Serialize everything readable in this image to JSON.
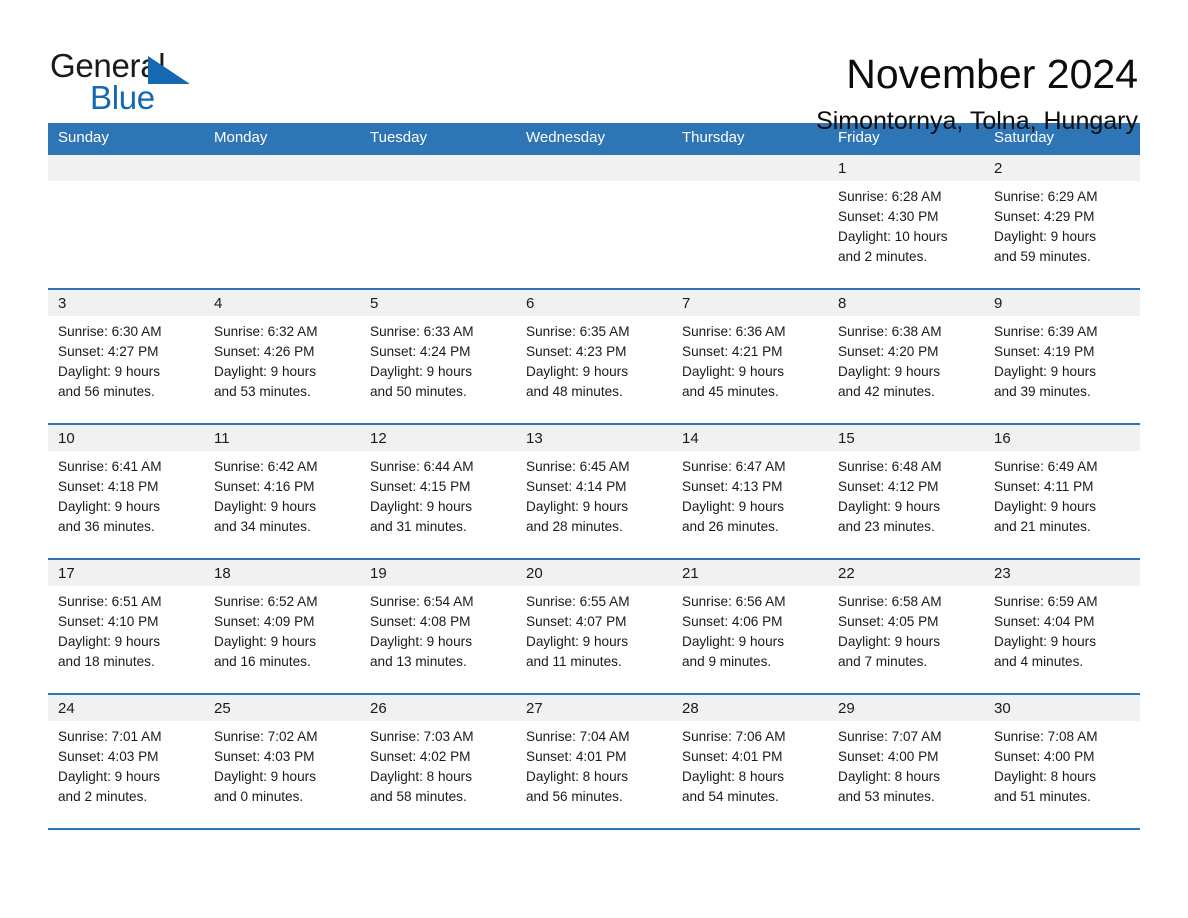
{
  "brand": {
    "name_part1": "General",
    "name_part2": "Blue",
    "accent_color": "#1569b0"
  },
  "header": {
    "title": "November 2024",
    "location": "Simontornya, Tolna, Hungary"
  },
  "theme": {
    "header_blue": "#2e75b6",
    "daynum_band": "#f1f1f1",
    "cell_background": "#ffffff"
  },
  "weekday_headers": [
    "Sunday",
    "Monday",
    "Tuesday",
    "Wednesday",
    "Thursday",
    "Friday",
    "Saturday"
  ],
  "weeks": [
    [
      {
        "day": "",
        "sunrise": "",
        "sunset": "",
        "daylight_line1": "",
        "daylight_line2": ""
      },
      {
        "day": "",
        "sunrise": "",
        "sunset": "",
        "daylight_line1": "",
        "daylight_line2": ""
      },
      {
        "day": "",
        "sunrise": "",
        "sunset": "",
        "daylight_line1": "",
        "daylight_line2": ""
      },
      {
        "day": "",
        "sunrise": "",
        "sunset": "",
        "daylight_line1": "",
        "daylight_line2": ""
      },
      {
        "day": "",
        "sunrise": "",
        "sunset": "",
        "daylight_line1": "",
        "daylight_line2": ""
      },
      {
        "day": "1",
        "sunrise": "Sunrise: 6:28 AM",
        "sunset": "Sunset: 4:30 PM",
        "daylight_line1": "Daylight: 10 hours",
        "daylight_line2": "and 2 minutes."
      },
      {
        "day": "2",
        "sunrise": "Sunrise: 6:29 AM",
        "sunset": "Sunset: 4:29 PM",
        "daylight_line1": "Daylight: 9 hours",
        "daylight_line2": "and 59 minutes."
      }
    ],
    [
      {
        "day": "3",
        "sunrise": "Sunrise: 6:30 AM",
        "sunset": "Sunset: 4:27 PM",
        "daylight_line1": "Daylight: 9 hours",
        "daylight_line2": "and 56 minutes."
      },
      {
        "day": "4",
        "sunrise": "Sunrise: 6:32 AM",
        "sunset": "Sunset: 4:26 PM",
        "daylight_line1": "Daylight: 9 hours",
        "daylight_line2": "and 53 minutes."
      },
      {
        "day": "5",
        "sunrise": "Sunrise: 6:33 AM",
        "sunset": "Sunset: 4:24 PM",
        "daylight_line1": "Daylight: 9 hours",
        "daylight_line2": "and 50 minutes."
      },
      {
        "day": "6",
        "sunrise": "Sunrise: 6:35 AM",
        "sunset": "Sunset: 4:23 PM",
        "daylight_line1": "Daylight: 9 hours",
        "daylight_line2": "and 48 minutes."
      },
      {
        "day": "7",
        "sunrise": "Sunrise: 6:36 AM",
        "sunset": "Sunset: 4:21 PM",
        "daylight_line1": "Daylight: 9 hours",
        "daylight_line2": "and 45 minutes."
      },
      {
        "day": "8",
        "sunrise": "Sunrise: 6:38 AM",
        "sunset": "Sunset: 4:20 PM",
        "daylight_line1": "Daylight: 9 hours",
        "daylight_line2": "and 42 minutes."
      },
      {
        "day": "9",
        "sunrise": "Sunrise: 6:39 AM",
        "sunset": "Sunset: 4:19 PM",
        "daylight_line1": "Daylight: 9 hours",
        "daylight_line2": "and 39 minutes."
      }
    ],
    [
      {
        "day": "10",
        "sunrise": "Sunrise: 6:41 AM",
        "sunset": "Sunset: 4:18 PM",
        "daylight_line1": "Daylight: 9 hours",
        "daylight_line2": "and 36 minutes."
      },
      {
        "day": "11",
        "sunrise": "Sunrise: 6:42 AM",
        "sunset": "Sunset: 4:16 PM",
        "daylight_line1": "Daylight: 9 hours",
        "daylight_line2": "and 34 minutes."
      },
      {
        "day": "12",
        "sunrise": "Sunrise: 6:44 AM",
        "sunset": "Sunset: 4:15 PM",
        "daylight_line1": "Daylight: 9 hours",
        "daylight_line2": "and 31 minutes."
      },
      {
        "day": "13",
        "sunrise": "Sunrise: 6:45 AM",
        "sunset": "Sunset: 4:14 PM",
        "daylight_line1": "Daylight: 9 hours",
        "daylight_line2": "and 28 minutes."
      },
      {
        "day": "14",
        "sunrise": "Sunrise: 6:47 AM",
        "sunset": "Sunset: 4:13 PM",
        "daylight_line1": "Daylight: 9 hours",
        "daylight_line2": "and 26 minutes."
      },
      {
        "day": "15",
        "sunrise": "Sunrise: 6:48 AM",
        "sunset": "Sunset: 4:12 PM",
        "daylight_line1": "Daylight: 9 hours",
        "daylight_line2": "and 23 minutes."
      },
      {
        "day": "16",
        "sunrise": "Sunrise: 6:49 AM",
        "sunset": "Sunset: 4:11 PM",
        "daylight_line1": "Daylight: 9 hours",
        "daylight_line2": "and 21 minutes."
      }
    ],
    [
      {
        "day": "17",
        "sunrise": "Sunrise: 6:51 AM",
        "sunset": "Sunset: 4:10 PM",
        "daylight_line1": "Daylight: 9 hours",
        "daylight_line2": "and 18 minutes."
      },
      {
        "day": "18",
        "sunrise": "Sunrise: 6:52 AM",
        "sunset": "Sunset: 4:09 PM",
        "daylight_line1": "Daylight: 9 hours",
        "daylight_line2": "and 16 minutes."
      },
      {
        "day": "19",
        "sunrise": "Sunrise: 6:54 AM",
        "sunset": "Sunset: 4:08 PM",
        "daylight_line1": "Daylight: 9 hours",
        "daylight_line2": "and 13 minutes."
      },
      {
        "day": "20",
        "sunrise": "Sunrise: 6:55 AM",
        "sunset": "Sunset: 4:07 PM",
        "daylight_line1": "Daylight: 9 hours",
        "daylight_line2": "and 11 minutes."
      },
      {
        "day": "21",
        "sunrise": "Sunrise: 6:56 AM",
        "sunset": "Sunset: 4:06 PM",
        "daylight_line1": "Daylight: 9 hours",
        "daylight_line2": "and 9 minutes."
      },
      {
        "day": "22",
        "sunrise": "Sunrise: 6:58 AM",
        "sunset": "Sunset: 4:05 PM",
        "daylight_line1": "Daylight: 9 hours",
        "daylight_line2": "and 7 minutes."
      },
      {
        "day": "23",
        "sunrise": "Sunrise: 6:59 AM",
        "sunset": "Sunset: 4:04 PM",
        "daylight_line1": "Daylight: 9 hours",
        "daylight_line2": "and 4 minutes."
      }
    ],
    [
      {
        "day": "24",
        "sunrise": "Sunrise: 7:01 AM",
        "sunset": "Sunset: 4:03 PM",
        "daylight_line1": "Daylight: 9 hours",
        "daylight_line2": "and 2 minutes."
      },
      {
        "day": "25",
        "sunrise": "Sunrise: 7:02 AM",
        "sunset": "Sunset: 4:03 PM",
        "daylight_line1": "Daylight: 9 hours",
        "daylight_line2": "and 0 minutes."
      },
      {
        "day": "26",
        "sunrise": "Sunrise: 7:03 AM",
        "sunset": "Sunset: 4:02 PM",
        "daylight_line1": "Daylight: 8 hours",
        "daylight_line2": "and 58 minutes."
      },
      {
        "day": "27",
        "sunrise": "Sunrise: 7:04 AM",
        "sunset": "Sunset: 4:01 PM",
        "daylight_line1": "Daylight: 8 hours",
        "daylight_line2": "and 56 minutes."
      },
      {
        "day": "28",
        "sunrise": "Sunrise: 7:06 AM",
        "sunset": "Sunset: 4:01 PM",
        "daylight_line1": "Daylight: 8 hours",
        "daylight_line2": "and 54 minutes."
      },
      {
        "day": "29",
        "sunrise": "Sunrise: 7:07 AM",
        "sunset": "Sunset: 4:00 PM",
        "daylight_line1": "Daylight: 8 hours",
        "daylight_line2": "and 53 minutes."
      },
      {
        "day": "30",
        "sunrise": "Sunrise: 7:08 AM",
        "sunset": "Sunset: 4:00 PM",
        "daylight_line1": "Daylight: 8 hours",
        "daylight_line2": "and 51 minutes."
      }
    ]
  ]
}
